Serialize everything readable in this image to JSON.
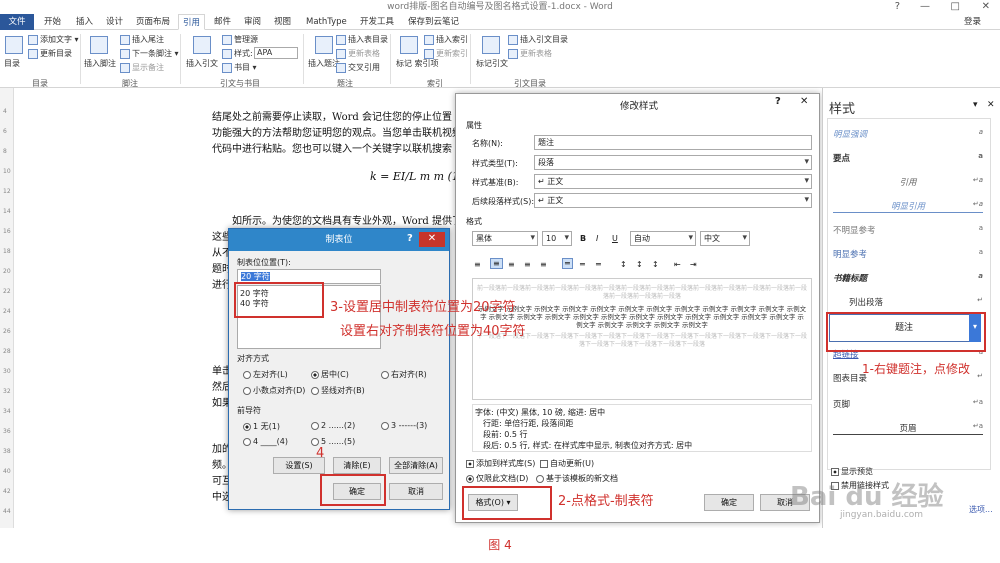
{
  "window": {
    "title": "word排版-图名自动编号及图名格式设置-1.docx - Word",
    "signin": "登录",
    "controls": [
      "?",
      "—",
      "□",
      "✕"
    ]
  },
  "tabs": [
    "文件",
    "开始",
    "插入",
    "设计",
    "页面布局",
    "引用",
    "邮件",
    "审阅",
    "视图",
    "MathType",
    "开发工具",
    "保存到云笔记"
  ],
  "ribbon": {
    "toc": {
      "big": "目录",
      "add_text": "添加文字 ▾",
      "update": "更新目录",
      "group": "目录"
    },
    "footnote": {
      "insert": "插入脚注",
      "insert_endnote": "插入尾注",
      "next": "下一条脚注 ▾",
      "show": "显示备注",
      "group": "脚注"
    },
    "citation": {
      "insert": "插入引文",
      "manage": "管理源",
      "style_label": "样式:",
      "style_value": "APA",
      "biblio": "书目 ▾",
      "group": "引文与书目"
    },
    "caption": {
      "insert": "插入题注",
      "table_of_figures": "插入表目录",
      "update_table": "更新表格",
      "cross_ref": "交叉引用",
      "group": "题注"
    },
    "index": {
      "mark": "标记\n索引项",
      "insert": "插入索引",
      "update": "更新索引",
      "group": "索引"
    },
    "toa": {
      "mark": "标记引文",
      "insert": "插入引文目录",
      "update": "更新表格",
      "group": "引文目录"
    }
  },
  "document": {
    "lines": [
      "结尾处之前需要停止读取，Word 会记住您的停止位置 -",
      "功能强大的方法帮助您证明您的观点。当您单击联机视频",
      "代码中进行粘贴。您也可以键入一个关键字以联机搜索",
      "如所示。为使您的文档具有专业外观，Word 提供了",
      "这些",
      "从不",
      "题时",
      "进行",
      "单击",
      "然后",
      "如果",
      "加的",
      "频。",
      "可互",
      "中选"
    ],
    "formula": "k = EI/L m m (1)"
  },
  "modify_style": {
    "title": "修改样式",
    "help": "?",
    "close": "✕",
    "section_props": "属性",
    "name_label": "名称(N):",
    "name_value": "题注",
    "type_label": "样式类型(T):",
    "type_value": "段落",
    "based_label": "样式基准(B):",
    "based_value": "↵ 正文",
    "next_label": "后续段落样式(S):",
    "next_value": "↵ 正文",
    "section_format": "格式",
    "font": "黑体",
    "size": "10",
    "bold": "B",
    "italic": "I",
    "underline": "U",
    "color": "自动",
    "lang": "中文",
    "preview_prev": "前一段落前一段落前一段落前一段落前一段落前一段落前一段落前一段落前一段落前一段落前一段落前一段落前一段落前一段落前一段落前一段落前一段落",
    "preview_sample": "示例文字 示例文字 示例文字 示例文字 示例文字 示例文字 示例文字 示例文字 示例文字 示例文字 示例文字 示例文字 示例文字 示例文字 示例文字 示例文字 示例文字 示例文字 示例文字 示例文字 示例文字 示例文字 示例文字 示例文字 示例文字 示例文字 示例文字 示例文字",
    "preview_next": "下一段落下一段落下一段落下一段落下一段落下一段落下一段落下一段落下一段落下一段落下一段落下一段落下一段落下一段落下一段落下一段落下一段落下一段落下一段落",
    "desc": [
      "字体: (中文) 黑体, 10 磅, 缩进: 居中",
      "行距: 单倍行距, 段落间距",
      "段前: 0.5 行",
      "段后: 0.5 行, 样式: 在样式库中显示, 制表位对齐方式: 居中"
    ],
    "add_gallery": "添加到样式库(S)",
    "auto_update": "自动更新(U)",
    "only_doc": "仅限此文档(D)",
    "new_docs": "基于该模板的新文档",
    "format_btn": "格式(O) ▾",
    "ok": "确定",
    "cancel": "取消"
  },
  "tabs_dialog": {
    "title": "制表位",
    "help": "?",
    "close": "✕",
    "pos_label": "制表位位置(T):",
    "pos_value": "20 字符",
    "positions": [
      "20 字符",
      "40 字符"
    ],
    "align_label": "对齐方式",
    "align": [
      "左对齐(L)",
      "居中(C)",
      "右对齐(R)",
      "小数点对齐(D)",
      "竖线对齐(B)"
    ],
    "leader_label": "前导符",
    "leaders": [
      "1 无(1)",
      "2 ......(2)",
      "3 ------(3)",
      "4 ____(4)",
      "5 ......(5)"
    ],
    "set": "设置(S)",
    "clear": "清除(E)",
    "clear_all": "全部清除(A)",
    "ok": "确定",
    "cancel": "取消"
  },
  "styles_pane": {
    "title": "样式",
    "pin": "▾",
    "close": "✕",
    "items": [
      "明显强调",
      "要点",
      "引用",
      "明显引用",
      "不明显参考",
      "明显参考",
      "书籍标题",
      "列出段落",
      "题注",
      "超链接",
      "图表目录",
      "页脚",
      "页眉"
    ],
    "selected": "题注",
    "marks": [
      "a",
      "a",
      "↵a",
      "↵a",
      "a",
      "a",
      "a",
      "↵",
      "↵a",
      "a",
      "↵",
      "↵a",
      "↵a"
    ],
    "show_preview": "显示预览",
    "disable_linked": "禁用链接样式",
    "options": "选项..."
  },
  "annotations": {
    "a1": "1-右键题注，点修改",
    "a2": "2-点格式-制表符",
    "a3a": "3-设置居中制表符位置为20字符",
    "a3b": "设置右对齐制表符位置为40字符",
    "a4": "4"
  },
  "caption": "图 4",
  "watermark": "Bai du 经验",
  "watermark_url": "jingyan.baidu.com",
  "colors": {
    "accent": "#2b579a",
    "annotation": "#d0312d",
    "dialog_header": "#2f86c9"
  }
}
